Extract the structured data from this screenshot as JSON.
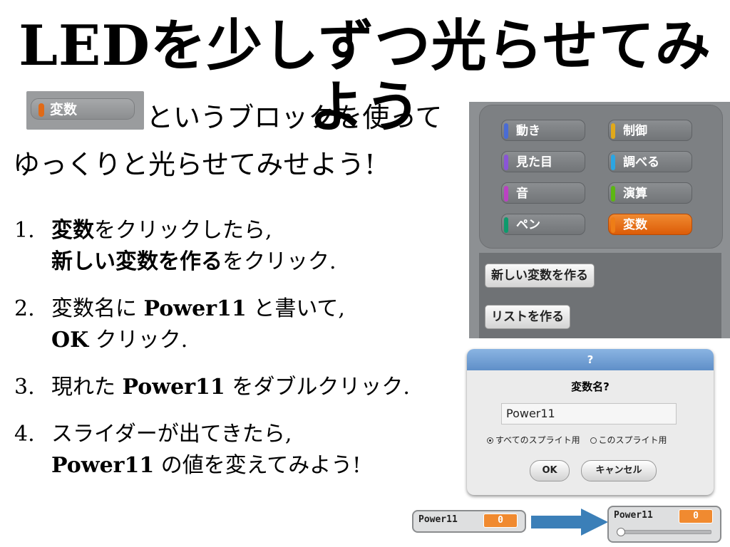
{
  "title": "LEDを少しずつ光らせてみよう",
  "intro": {
    "block_label": "変数",
    "line1": "というブロックを使って",
    "line2": "ゆっくりと光らせてみせよう!"
  },
  "steps": [
    {
      "num": "1.",
      "l1_bold": "変数",
      "l1_rest": "をクリックしたら,",
      "l2_bold": "新しい変数を作る",
      "l2_rest": "をクリック."
    },
    {
      "num": "2.",
      "l1_pre": "変数名に ",
      "l1_bold": "Power11",
      "l1_rest": " と書いて,",
      "l2_bold": "OK",
      "l2_rest": " クリック."
    },
    {
      "num": "3.",
      "l1_pre": "現れた ",
      "l1_bold": "Power11",
      "l1_rest": " をダブルクリック."
    },
    {
      "num": "4.",
      "l1_rest": "スライダーが出てきたら,",
      "l2_bold": "Power11",
      "l2_rest": " の値を変えてみよう!"
    }
  ],
  "palette": {
    "categories": [
      {
        "label": "動き",
        "color": "#4a6cd4"
      },
      {
        "label": "制御",
        "color": "#e1a91a"
      },
      {
        "label": "見た目",
        "color": "#8a55d7"
      },
      {
        "label": "調べる",
        "color": "#2ca5e2"
      },
      {
        "label": "音",
        "color": "#bb42c3"
      },
      {
        "label": "演算",
        "color": "#5cb712"
      },
      {
        "label": "ペン",
        "color": "#0e9a6c"
      },
      {
        "label": "変数",
        "color": "#ee7d16"
      }
    ],
    "active": "変数",
    "make_variable": "新しい変数を作る",
    "make_list": "リストを作る"
  },
  "dialog": {
    "title": "?",
    "prompt": "変数名?",
    "input_value": "Power11",
    "radio_all": "すべてのスプライト用",
    "radio_this": "このスプライト用",
    "selected_radio": "all",
    "ok": "OK",
    "cancel": "キャンセル"
  },
  "watchers": {
    "before": {
      "name": "Power11",
      "value": "0"
    },
    "after": {
      "name": "Power11",
      "value": "0"
    },
    "slider_fraction": 0.0
  },
  "colors": {
    "accent_orange": "#ee7d16",
    "arrow": "#3b7fb8"
  }
}
